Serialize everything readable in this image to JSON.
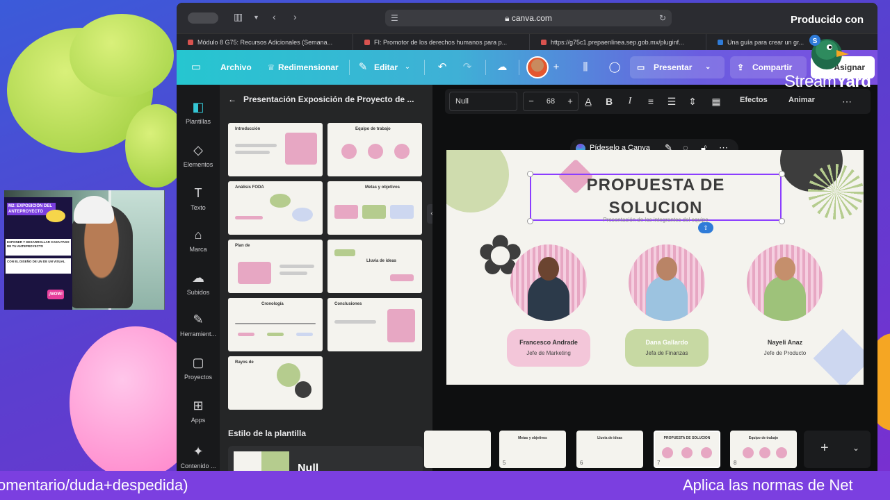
{
  "browser": {
    "url": "canva.com",
    "tabs": [
      {
        "label": "Módulo 8 G75: Recursos Adicionales (Semana..."
      },
      {
        "label": "FI: Promotor de los derechos humanos para p..."
      },
      {
        "label": "https://g75c1.prepaenlinea.sep.gob.mx/pluginf..."
      },
      {
        "label": "Una guía para crear un gr..."
      }
    ]
  },
  "canva_bar": {
    "archivo": "Archivo",
    "redimensionar": "Redimensionar",
    "editar": "Editar",
    "presentar": "Presentar",
    "compartir": "Compartir",
    "asignar": "Asignar"
  },
  "rail": {
    "items": [
      {
        "label": "Plantillas",
        "icon": "templates-icon"
      },
      {
        "label": "Elementos",
        "icon": "elements-icon"
      },
      {
        "label": "Texto",
        "icon": "text-icon"
      },
      {
        "label": "Marca",
        "icon": "brand-icon"
      },
      {
        "label": "Subidos",
        "icon": "upload-icon"
      },
      {
        "label": "Herramient...",
        "icon": "tools-icon"
      },
      {
        "label": "Proyectos",
        "icon": "folder-icon"
      },
      {
        "label": "Apps",
        "icon": "apps-icon"
      },
      {
        "label": "Contenido ...",
        "icon": "content-icon"
      }
    ]
  },
  "panel": {
    "title": "Presentación Exposición de Proyecto de ...",
    "thumbs": [
      {
        "title": "Introducción"
      },
      {
        "title": "Equipo de trabajo"
      },
      {
        "title": "Análisis FODA"
      },
      {
        "title": "Metas y objetivos"
      },
      {
        "title": "Plan de"
      },
      {
        "title": "Lluvia de ideas"
      },
      {
        "title": "Cronología"
      },
      {
        "title": "Conclusiones"
      },
      {
        "title": "Rayos de"
      }
    ],
    "style_title": "Estilo de la plantilla",
    "style_name": "Null"
  },
  "toolbar": {
    "font": "Null",
    "size": "68",
    "efectos": "Efectos",
    "animar": "Animar"
  },
  "ask_canva": "Pídeselo a Canva",
  "slide": {
    "title_line1": "PROPUESTA DE",
    "title_line2": "SOLUCION",
    "subtitle": "Presentación de los integrantes del equipo",
    "members": [
      {
        "name": "Francesco Andrade",
        "role": "Jefe de Marketing"
      },
      {
        "name": "Dana Gallardo",
        "role": "Jefa de Finanzas"
      },
      {
        "name": "Nayeli Anaz",
        "role": "Jefe de Producto"
      }
    ]
  },
  "filmstrip": {
    "pages": [
      {
        "num": "",
        "label": ""
      },
      {
        "num": "5",
        "label": "Metas y objetivos"
      },
      {
        "num": "6",
        "label": "Lluvia de ideas"
      },
      {
        "num": "7",
        "label": "PROPUESTA DE SOLUCION"
      },
      {
        "num": "8",
        "label": "Equipo de trabajo"
      }
    ]
  },
  "webcam": {
    "card_title": "M2: EXPOSICIÓN DEL ANTEPROYECTO",
    "card_text1": "EXPONER Y DESARROLLAR CADA PASO DE TU ANTEPROYECTO",
    "card_text2": "CON EL DISEÑO DE UN DE UN VISUAL",
    "sticker": "¡WOW!"
  },
  "streamyard": {
    "produced": "Producido con",
    "brand_a": "Stream",
    "brand_b": "Yard"
  },
  "ticker": {
    "left": "omentario/duda+despedida)",
    "right": "Aplica las normas de Net"
  },
  "colors": {
    "canva_gradient_start": "#26c6d0",
    "canva_gradient_end": "#7b4fe0",
    "ticker_bg": "#7b3fe0",
    "selection": "#8b3dff"
  }
}
